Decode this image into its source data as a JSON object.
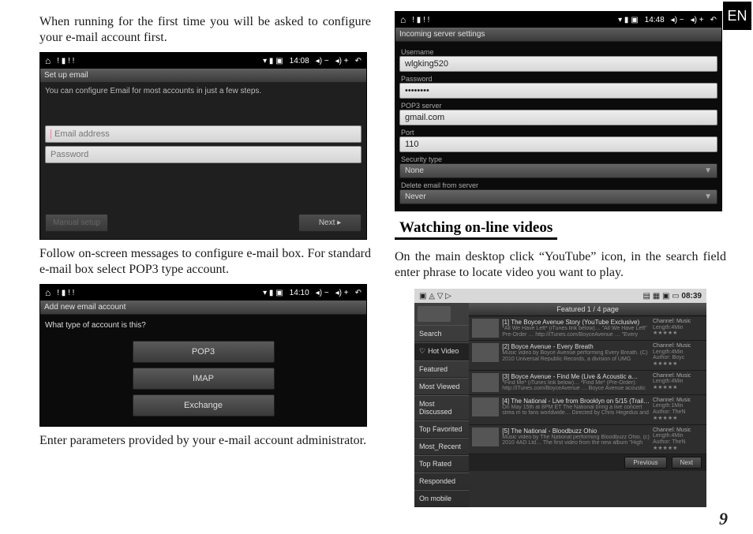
{
  "lang_tab": "EN",
  "page_number": "9",
  "left": {
    "p1": "When running for the first time you will be asked to configure your e-mail account first.",
    "p2": "Follow on-screen messages to configure e-mail box. For standard e-mail box select POP3 type account.",
    "p3": "Enter parameters provided by your e-mail account administrator."
  },
  "shot1": {
    "time": "14:08",
    "title": "Set up email",
    "msg": "You can configure Email for most accounts in just a few steps.",
    "ph_email": "Email address",
    "ph_pass": "Password",
    "btn_manual": "Manual setup",
    "btn_next": "Next  ▸"
  },
  "shot2": {
    "time": "14:10",
    "title": "Add new email account",
    "q": "What type of account is this?",
    "btns": [
      "POP3",
      "IMAP",
      "Exchange"
    ]
  },
  "shot3": {
    "time": "14:48",
    "title": "Incoming server settings",
    "fields": {
      "user_lbl": "Username",
      "user_val": "wlgking520",
      "pwd_lbl": "Password",
      "pwd_val": "••••••••",
      "srv_lbl": "POP3 server",
      "srv_val": "gmail.com",
      "port_lbl": "Port",
      "port_val": "110",
      "sec_lbl": "Security type",
      "sec_val": "None",
      "del_lbl": "Delete email from server",
      "del_val": "Never"
    }
  },
  "right": {
    "heading": "Watching on-line videos",
    "p1": "On the main desktop click “YouTube” icon, in the search field enter phrase to locate video you want to play."
  },
  "yt": {
    "time": "08:39",
    "header": "Featured 1 / 4 page",
    "tabs": [
      "Search",
      "Hot Video",
      "Featured",
      "Most Viewed",
      "Most Discussed",
      "Top Favorited",
      "Most_Recent",
      "Top Rated",
      "Responded",
      "On mobile"
    ],
    "rows": [
      {
        "title": "[1] The Boyce Avenue Story (YouTube Exclusive)",
        "desc": "*All We Have Left* (iTunes link below)…  \"All We Have Left\" Pre-Order … http://iTunes.com/BoyceAvenue … \"Every Breath\"",
        "ch": "Channel: Music",
        "len": "Length:4Min"
      },
      {
        "title": "[2] Boyce Avenue - Every Breath",
        "desc": "Music video by Boyce Avenue performing Every Breath. (C) 2010 Universal Republic Records, a division of UMG Recordings, I…",
        "ch": "Channel: Music",
        "len": "Length:4Min",
        "auth": "Author: Boyc"
      },
      {
        "title": "[3] Boyce Avenue - Find Me (Live & Acoustic a…",
        "desc": "*Find Me* (iTunes link below)…  *Find Me* (Pre-Order): http://iTunes.com/BoyceAvenue … Boyce Avenue acoustic studio…",
        "ch": "Channel: Music",
        "len": "Length:4Min"
      },
      {
        "title": "[4] The National - Live from Brooklyn on 5/15 (Trail…",
        "desc": "On May 15th at 8PM ET The National bring a live concert strea m to fans worldwide… Directed by Chris Hegedus and DA Pen…",
        "ch": "Channel: Music",
        "len": "Length:1Min",
        "auth": "Author: TheN"
      },
      {
        "title": "[5] The National - Bloodbuzz Ohio",
        "desc": "Music video by The National performing Bloodbuzz Ohio. (c) 2010 4AD Ltd… The first video from the new album \"High Vio…",
        "ch": "Channel: Music",
        "len": "Length:4Min",
        "auth": "Author: TheN"
      }
    ],
    "prev": "Previous",
    "next": "Next"
  }
}
